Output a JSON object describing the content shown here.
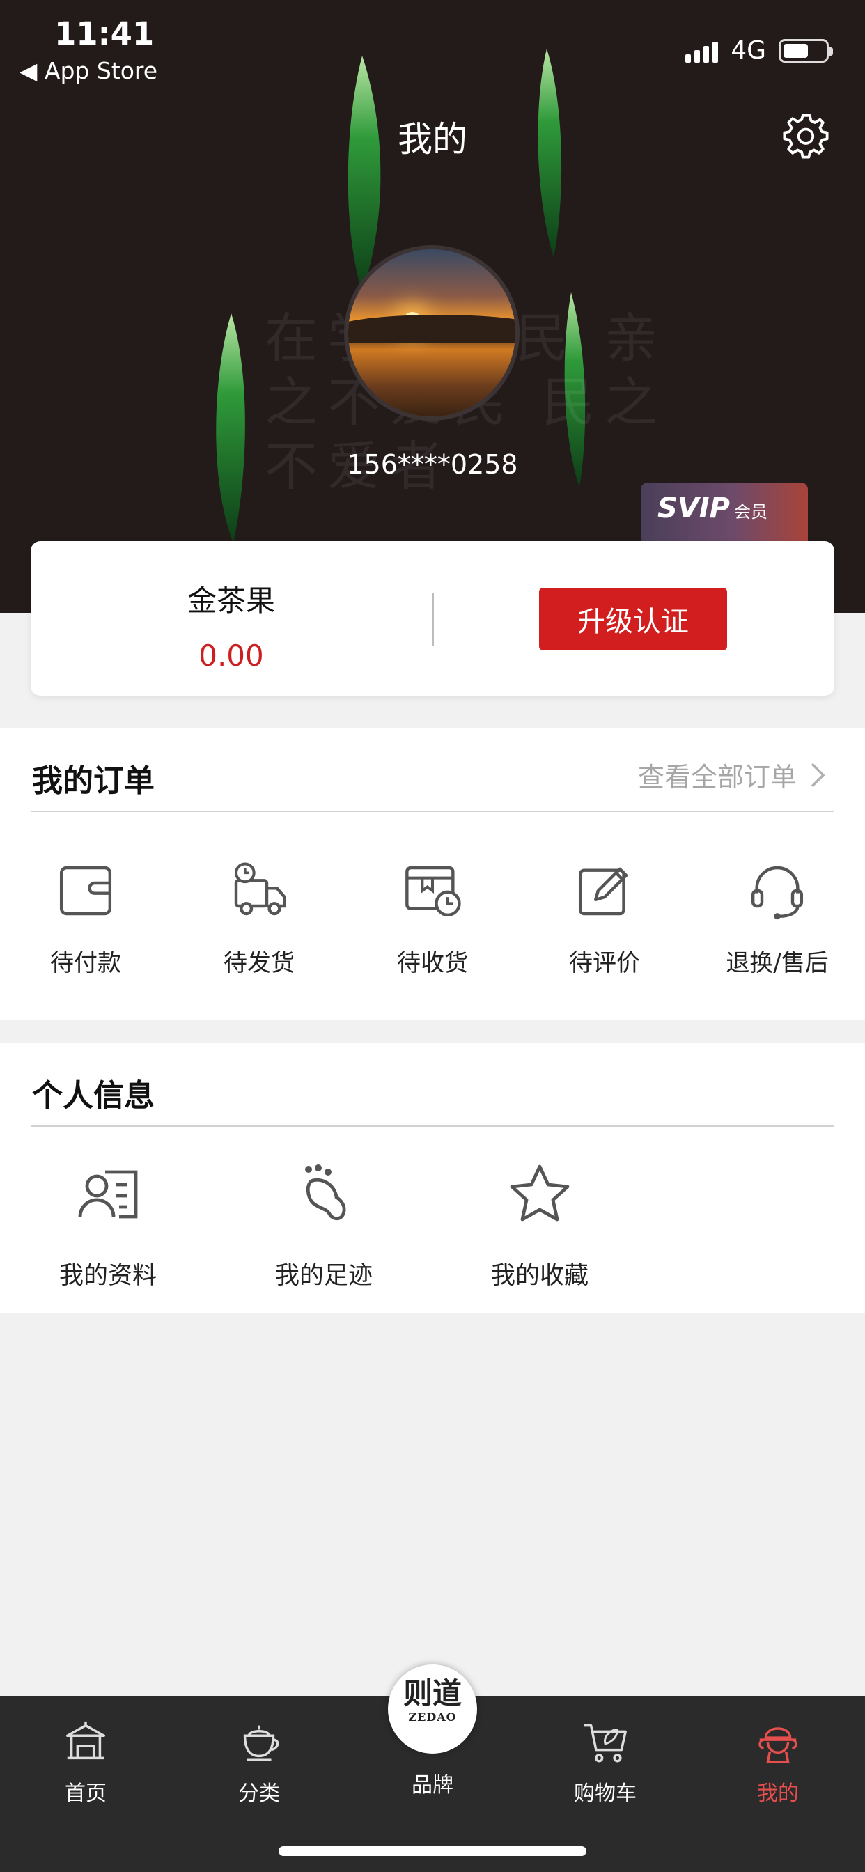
{
  "status_bar": {
    "time": "11:41",
    "back_app": "◀ App Store",
    "network": "4G"
  },
  "header": {
    "title": "我的",
    "background_chars": "在学历者民 亲之不爱民 民之不爱者",
    "phone": "156****0258",
    "svip": {
      "text": "SVIP",
      "label": "会员"
    }
  },
  "wallet": {
    "title": "金茶果",
    "value": "0.00",
    "upgrade_label": "升级认证"
  },
  "orders": {
    "title": "我的订单",
    "view_all": "查看全部订单",
    "items": [
      {
        "label": "待付款",
        "icon": "wallet-icon"
      },
      {
        "label": "待发货",
        "icon": "delivery-truck-icon"
      },
      {
        "label": "待收货",
        "icon": "package-clock-icon"
      },
      {
        "label": "待评价",
        "icon": "edit-icon"
      },
      {
        "label": "退换/售后",
        "icon": "headset-icon"
      }
    ]
  },
  "profile": {
    "title": "个人信息",
    "items": [
      {
        "label": "我的资料",
        "icon": "profile-card-icon"
      },
      {
        "label": "我的足迹",
        "icon": "footprint-icon"
      },
      {
        "label": "我的收藏",
        "icon": "star-icon"
      }
    ]
  },
  "tabbar": {
    "items": [
      {
        "label": "首页",
        "icon": "home-pavilion-icon"
      },
      {
        "label": "分类",
        "icon": "teapot-icon"
      },
      {
        "label": "品牌",
        "icon": "brand-logo"
      },
      {
        "label": "购物车",
        "icon": "cart-icon"
      },
      {
        "label": "我的",
        "icon": "profile-icon"
      }
    ],
    "brand_logo": {
      "cn": "则道",
      "en": "ZEDAO"
    },
    "active_color": "#e74e4e"
  },
  "colors": {
    "accent_red": "#d21e1e",
    "value_red": "#cc1f1f",
    "header_bg": "#231a1a"
  }
}
